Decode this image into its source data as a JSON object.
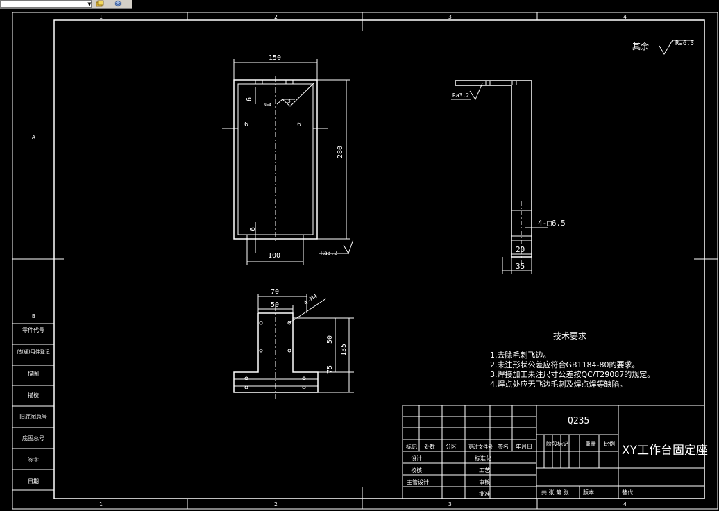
{
  "toolbar": {
    "combo_value": ""
  },
  "frame": {
    "zones_x": [
      "1",
      "2",
      "3",
      "4"
    ],
    "zones_y": [
      "A",
      "B"
    ]
  },
  "left_table": [
    "零件代号",
    "借(通)用件登记",
    "描图",
    "描校",
    "旧底图总号",
    "底图总号",
    "签字",
    "日期"
  ],
  "surface_finish": {
    "label": "其余",
    "value": "Ra6.3"
  },
  "front_view": {
    "dim_width": "150",
    "dim_height": "280",
    "dim_left_6": "6",
    "dim_right_6": "6",
    "dim_top_6": "6",
    "dim_bottom_6": "6",
    "dim_bottom": "100",
    "weld_n": "N=4",
    "weld_size": "3",
    "roughness": "Ra3.2"
  },
  "side_view": {
    "roughness": "Ra3.2",
    "hole_callout": "4-□6.5",
    "dim_20": "20",
    "dim_35": "35"
  },
  "bottom_view": {
    "dim_70": "70",
    "dim_50_top": "50",
    "thread": "4-M4",
    "dim_50_right": "50",
    "dim_135": "135",
    "dim_75": "75"
  },
  "tech_req": {
    "title": "技术要求",
    "items": [
      "1.去除毛刺飞边。",
      "2.未注形状公差应符合GB1184-80的要求。",
      "3.焊接加工未注尺寸公差按QC/T29087的规定。",
      "4.焊点处应无飞边毛刺及焊点焊等缺陷。"
    ]
  },
  "title_block": {
    "material": "Q235",
    "name": "XY工作台固定座",
    "header_row": [
      "标记",
      "处数",
      "分区",
      "更改文件号",
      "签名",
      "年月日"
    ],
    "stage_labels": [
      "阶段标记",
      "重量",
      "比例"
    ],
    "left_roles": [
      "设计",
      "校核",
      "主管设计"
    ],
    "right_roles": [
      "标准化",
      "工艺",
      "审核",
      "批准"
    ],
    "bottom_left": "共 张 第 张",
    "bottom_mid": "版本",
    "bottom_right": "替代"
  }
}
